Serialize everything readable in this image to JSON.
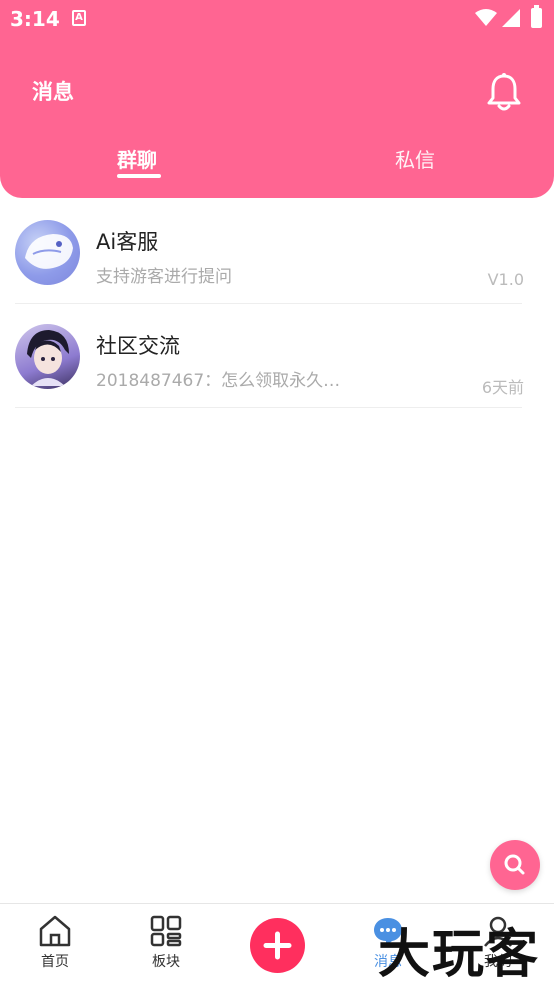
{
  "statusbar": {
    "time": "3:14",
    "a_icon": "A"
  },
  "header": {
    "title": "消息",
    "tabs": [
      {
        "label": "群聊",
        "active": true
      },
      {
        "label": "私信",
        "active": false
      }
    ],
    "accent": "#ff6592"
  },
  "conversations": [
    {
      "name": "Ai客服",
      "desc": "支持游客进行提问",
      "meta": "V1.0",
      "avatar": "ai-avatar"
    },
    {
      "name": "社区交流",
      "desc": "2018487467：怎么领取永久…",
      "meta": "6天前",
      "avatar": "community-avatar"
    }
  ],
  "bottom_nav": [
    {
      "label": "首页",
      "icon": "home-icon"
    },
    {
      "label": "板块",
      "icon": "grid-icon"
    },
    {
      "label": "",
      "icon": "add-icon"
    },
    {
      "label": "消息",
      "icon": "message-icon",
      "active": true
    },
    {
      "label": "我的",
      "icon": "user-icon"
    }
  ],
  "watermark": "大玩客"
}
